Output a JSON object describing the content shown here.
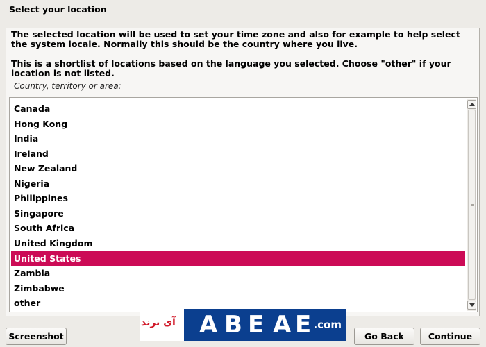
{
  "window": {
    "title": "Select your location"
  },
  "description": {
    "paragraph1": "The selected location will be used to set your time zone and also for example to help select the system locale. Normally this should be the country where you live.",
    "paragraph2": "This is a shortlist of locations based on the language you selected. Choose \"other\" if your location is not listed.",
    "field_label": "Country, territory or area:"
  },
  "location_list": {
    "items": [
      {
        "label": "Canada",
        "selected": false
      },
      {
        "label": "Hong Kong",
        "selected": false
      },
      {
        "label": "India",
        "selected": false
      },
      {
        "label": "Ireland",
        "selected": false
      },
      {
        "label": "New Zealand",
        "selected": false
      },
      {
        "label": "Nigeria",
        "selected": false
      },
      {
        "label": "Philippines",
        "selected": false
      },
      {
        "label": "Singapore",
        "selected": false
      },
      {
        "label": "South Africa",
        "selected": false
      },
      {
        "label": "United Kingdom",
        "selected": false
      },
      {
        "label": "United States",
        "selected": true
      },
      {
        "label": "Zambia",
        "selected": false
      },
      {
        "label": "Zimbabwe",
        "selected": false
      },
      {
        "label": "other",
        "selected": false
      }
    ],
    "selected_color": "#cc0b56"
  },
  "buttons": {
    "screenshot": "Screenshot",
    "go_back": "Go Back",
    "continue": "Continue"
  },
  "watermark": {
    "left_text": "آی ترند",
    "glyphs": [
      "A",
      "B",
      "E",
      "A",
      "E"
    ],
    "suffix": ".com",
    "colors": {
      "red": "#d11a2a",
      "blue": "#0b3f8f"
    }
  }
}
